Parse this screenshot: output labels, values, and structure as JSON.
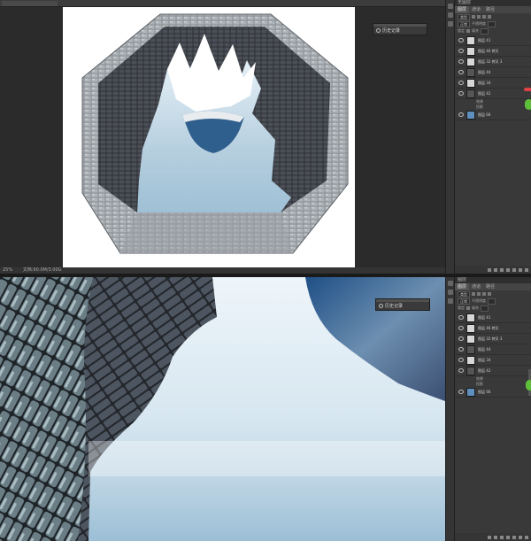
{
  "top": {
    "doc_tab": "  ",
    "status": {
      "zoom": "25%",
      "doc": "文档:90.0M/3.00G"
    },
    "history_label": "历史记录",
    "panel_title": "无图层",
    "panel_tabs": [
      "图层",
      "通道",
      "路径"
    ],
    "kind_filter": "类型",
    "blend_mode": "正常",
    "opacity_label": "不透明度",
    "lock_label": "锁定",
    "fill_label": "填充",
    "layers": [
      {
        "name": "图层 41",
        "thumb": "light"
      },
      {
        "name": "图层 46 拷贝",
        "thumb": "light"
      },
      {
        "name": "图层 32 拷贝 3",
        "thumb": "light"
      },
      {
        "name": "图层 44",
        "thumb": "dark"
      },
      {
        "name": "图层 34",
        "thumb": "light"
      },
      {
        "name": "图层 42",
        "thumb": "dark",
        "effects": [
          "效果",
          "投影"
        ]
      },
      {
        "name": "图层 66",
        "thumb": "blue"
      }
    ]
  },
  "bottom": {
    "history_label": "历史记录",
    "panel_title": "图层",
    "panel_tabs": [
      "图层",
      "通道",
      "路径"
    ],
    "kind_filter": "类型",
    "blend_mode": "正常",
    "opacity_label": "不透明度",
    "lock_label": "锁定",
    "fill_label": "填充",
    "layers": [
      {
        "name": "图层 41",
        "thumb": "light"
      },
      {
        "name": "图层 46 拷贝",
        "thumb": "light"
      },
      {
        "name": "图层 32 拷贝 3",
        "thumb": "light"
      },
      {
        "name": "图层 44",
        "thumb": "dark"
      },
      {
        "name": "图层 34",
        "thumb": "light"
      },
      {
        "name": "图层 42",
        "thumb": "dark",
        "effects": [
          "效果",
          "投影"
        ]
      },
      {
        "name": "图层 66",
        "thumb": "blue"
      }
    ]
  }
}
